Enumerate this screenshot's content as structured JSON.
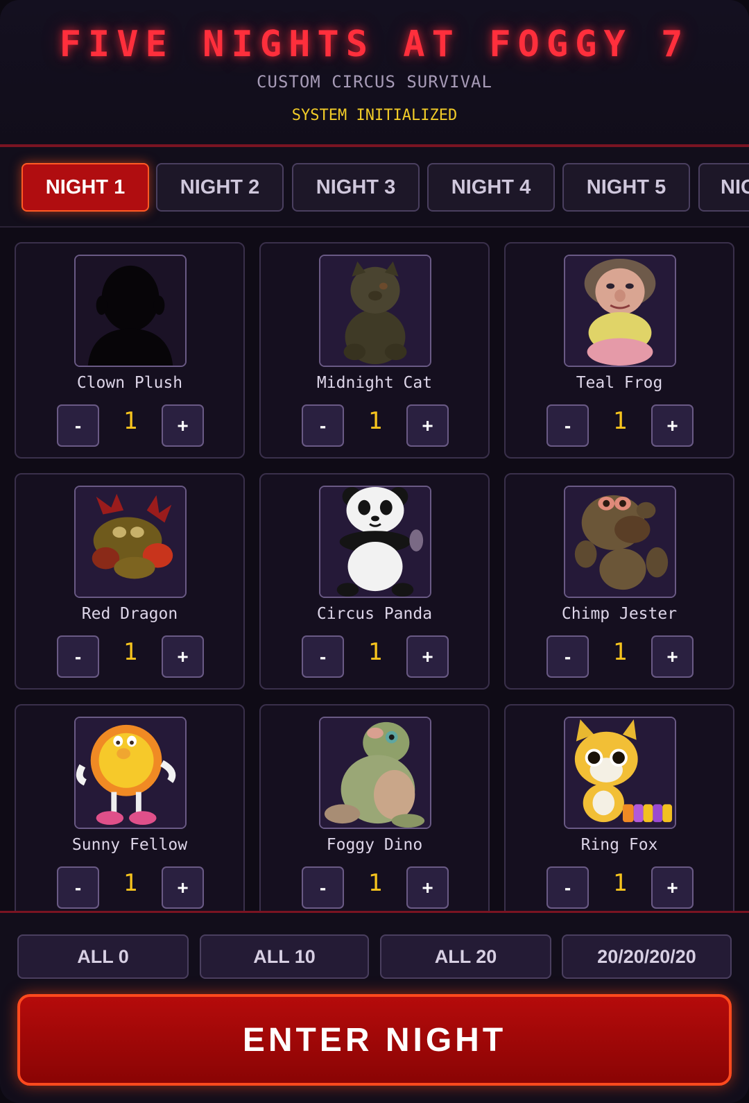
{
  "header": {
    "title": "FIVE NIGHTS AT FOGGY 7",
    "subtitle": "CUSTOM CIRCUS SURVIVAL",
    "status": "SYSTEM INITIALIZED"
  },
  "tabs": [
    {
      "label": "NIGHT 1",
      "active": true
    },
    {
      "label": "NIGHT 2",
      "active": false
    },
    {
      "label": "NIGHT 3",
      "active": false
    },
    {
      "label": "NIGHT 4",
      "active": false
    },
    {
      "label": "NIGHT 5",
      "active": false
    },
    {
      "label": "NIG",
      "active": false
    }
  ],
  "characters": [
    {
      "name": "Clown Plush",
      "count": "1",
      "minus": "-",
      "plus": "+",
      "icon": "silhouette-icon"
    },
    {
      "name": "Midnight Cat",
      "count": "1",
      "minus": "-",
      "plus": "+",
      "icon": "cat-plush-icon"
    },
    {
      "name": "Teal Frog",
      "count": "1",
      "minus": "-",
      "plus": "+",
      "icon": "doll-plush-icon"
    },
    {
      "name": "Red Dragon",
      "count": "1",
      "minus": "-",
      "plus": "+",
      "icon": "dragon-plush-icon"
    },
    {
      "name": "Circus Panda",
      "count": "1",
      "minus": "-",
      "plus": "+",
      "icon": "panda-plush-icon"
    },
    {
      "name": "Chimp Jester",
      "count": "1",
      "minus": "-",
      "plus": "+",
      "icon": "monkey-plush-icon"
    },
    {
      "name": "Sunny Fellow",
      "count": "1",
      "minus": "-",
      "plus": "+",
      "icon": "sun-plush-icon"
    },
    {
      "name": "Foggy Dino",
      "count": "1",
      "minus": "-",
      "plus": "+",
      "icon": "dino-plush-icon"
    },
    {
      "name": "Ring Fox",
      "count": "1",
      "minus": "-",
      "plus": "+",
      "icon": "fox-plush-icon"
    }
  ],
  "presets": [
    "ALL 0",
    "ALL 10",
    "ALL 20",
    "20/20/20/20"
  ],
  "enter_label": "ENTER NIGHT",
  "colors": {
    "title": "#ff2f3c",
    "status": "#f2cc28",
    "count": "#f6c41e",
    "accent": "#b00d10",
    "accent_border": "#ff4a1e",
    "panel_border": "#6a5a85"
  }
}
